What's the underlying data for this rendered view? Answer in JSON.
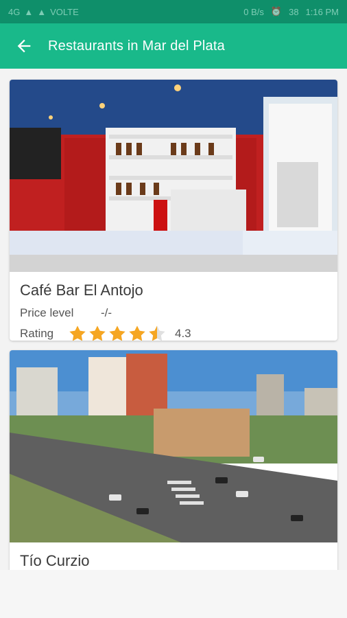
{
  "statusbar": {
    "signal_text": "4G",
    "volte": "VOLTE",
    "speed": "0 B/s",
    "battery": "38",
    "time": "1:16 PM"
  },
  "appbar": {
    "title": "Restaurants in Mar del Plata",
    "back_icon": "arrow-left-icon"
  },
  "restaurants": [
    {
      "name": "Café Bar El Antojo",
      "price_label": "Price level",
      "price_value": "-/-",
      "rating_label": "Rating",
      "rating": "4.3"
    },
    {
      "name": "Tío Curzio"
    }
  ],
  "colors": {
    "primary": "#19b98a",
    "primary_dark": "#0f8f6a",
    "star": "#f5a623"
  }
}
